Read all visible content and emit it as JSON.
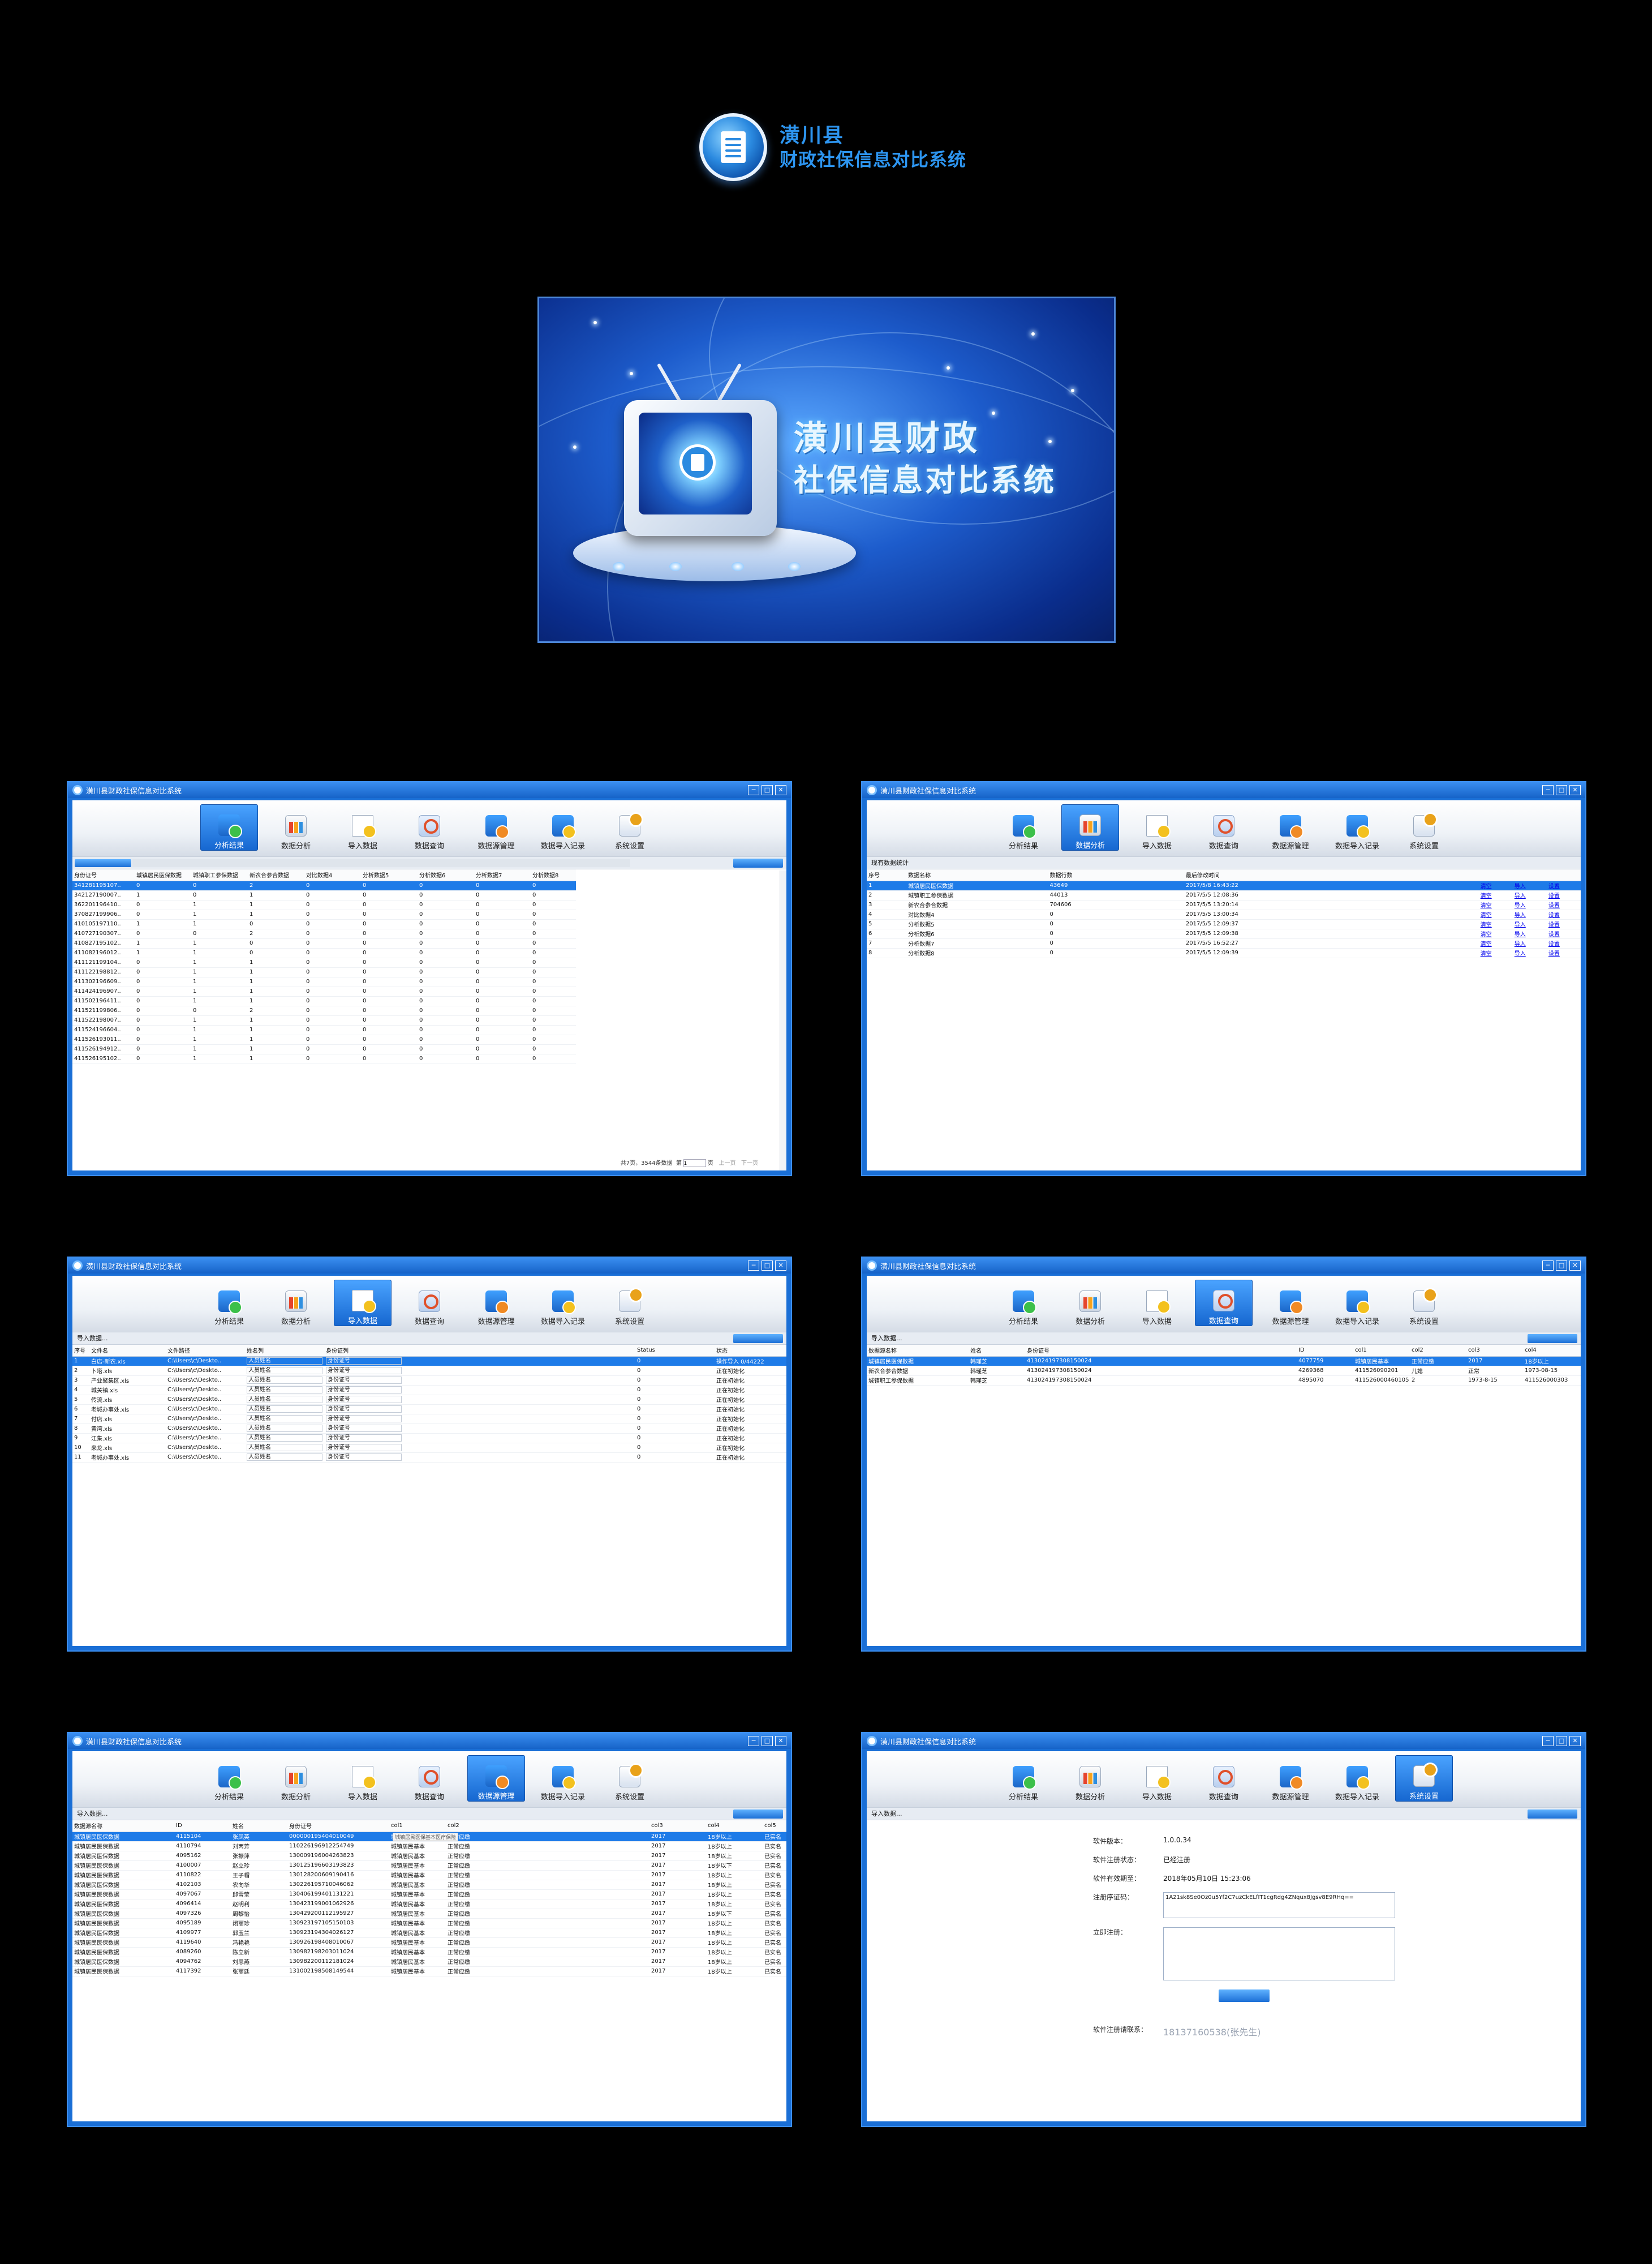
{
  "logo": {
    "line1": "潢川县",
    "line2": "财政社保信息对比系统"
  },
  "splash": {
    "line1": "潢川县财政",
    "line2": "社保信息对比系统"
  },
  "window_title": "潢川县财政社保信息对比系统",
  "window_buttons": [
    "─",
    "□",
    "✕"
  ],
  "tabs": [
    {
      "label": "分析结果",
      "icon": "analysis-result-icon"
    },
    {
      "label": "数据分析",
      "icon": "data-analysis-icon"
    },
    {
      "label": "导入数据",
      "icon": "import-data-icon"
    },
    {
      "label": "数据查询",
      "icon": "data-query-icon"
    },
    {
      "label": "数据源管理",
      "icon": "datasource-manage-icon"
    },
    {
      "label": "数据导入记录",
      "icon": "import-record-icon"
    },
    {
      "label": "系统设置",
      "icon": "settings-icon"
    }
  ],
  "win1": {
    "headers": [
      "身份证号",
      "城镇居民医保数据",
      "城镇职工参保数据",
      "新农合参合数据",
      "对比数据4",
      "分析数据5",
      "分析数据6",
      "分析数据7",
      "分析数据8"
    ],
    "rows": [
      [
        "341281195107..",
        "0",
        "0",
        "2",
        "0",
        "0",
        "0",
        "0",
        "0"
      ],
      [
        "342127190007..",
        "1",
        "0",
        "1",
        "0",
        "0",
        "0",
        "0",
        "0"
      ],
      [
        "362201196410..",
        "0",
        "1",
        "1",
        "0",
        "0",
        "0",
        "0",
        "0"
      ],
      [
        "370827199906..",
        "0",
        "1",
        "1",
        "0",
        "0",
        "0",
        "0",
        "0"
      ],
      [
        "410105197110..",
        "1",
        "1",
        "0",
        "0",
        "0",
        "0",
        "0",
        "0"
      ],
      [
        "410727190307..",
        "0",
        "0",
        "2",
        "0",
        "0",
        "0",
        "0",
        "0"
      ],
      [
        "410827195102..",
        "1",
        "1",
        "0",
        "0",
        "0",
        "0",
        "0",
        "0"
      ],
      [
        "411082196012..",
        "1",
        "1",
        "0",
        "0",
        "0",
        "0",
        "0",
        "0"
      ],
      [
        "411121199104..",
        "0",
        "1",
        "1",
        "0",
        "0",
        "0",
        "0",
        "0"
      ],
      [
        "411122198812..",
        "0",
        "1",
        "1",
        "0",
        "0",
        "0",
        "0",
        "0"
      ],
      [
        "411302196609..",
        "0",
        "1",
        "1",
        "0",
        "0",
        "0",
        "0",
        "0"
      ],
      [
        "411424196907..",
        "0",
        "1",
        "1",
        "0",
        "0",
        "0",
        "0",
        "0"
      ],
      [
        "411502196411..",
        "0",
        "1",
        "1",
        "0",
        "0",
        "0",
        "0",
        "0"
      ],
      [
        "411521199806..",
        "0",
        "0",
        "2",
        "0",
        "0",
        "0",
        "0",
        "0"
      ],
      [
        "411522198007..",
        "0",
        "1",
        "1",
        "0",
        "0",
        "0",
        "0",
        "0"
      ],
      [
        "411524196604..",
        "0",
        "1",
        "1",
        "0",
        "0",
        "0",
        "0",
        "0"
      ],
      [
        "411526193011..",
        "0",
        "1",
        "1",
        "0",
        "0",
        "0",
        "0",
        "0"
      ],
      [
        "411526194912..",
        "0",
        "1",
        "1",
        "0",
        "0",
        "0",
        "0",
        "0"
      ],
      [
        "411526195102..",
        "0",
        "1",
        "1",
        "0",
        "0",
        "0",
        "0",
        "0"
      ]
    ],
    "footer": "共7页，3544条数据",
    "page_label": "第",
    "page_value": "1",
    "page_unit": "页",
    "prev": "上一页",
    "next": "下一页"
  },
  "win2": {
    "strip": "现有数据统计",
    "headers": [
      "序号",
      "数据名称",
      "数据行数",
      "最后修改时间",
      "",
      "",
      ""
    ],
    "rows": [
      [
        "1",
        "城镇居民医保数据",
        "43649",
        "2017/5/8 16:43:22",
        "清空",
        "导入",
        "设置"
      ],
      [
        "2",
        "城镇职工参保数据",
        "44013",
        "2017/5/5 12:08:36",
        "清空",
        "导入",
        "设置"
      ],
      [
        "3",
        "新农合参合数据",
        "704606",
        "2017/5/5 13:20:14",
        "清空",
        "导入",
        "设置"
      ],
      [
        "4",
        "对比数据4",
        "0",
        "2017/5/5 13:00:34",
        "清空",
        "导入",
        "设置"
      ],
      [
        "5",
        "分析数据5",
        "0",
        "2017/5/5 12:09:37",
        "清空",
        "导入",
        "设置"
      ],
      [
        "6",
        "分析数据6",
        "0",
        "2017/5/5 12:09:38",
        "清空",
        "导入",
        "设置"
      ],
      [
        "7",
        "分析数据7",
        "0",
        "2017/5/5 16:52:27",
        "清空",
        "导入",
        "设置"
      ],
      [
        "8",
        "分析数据8",
        "0",
        "2017/5/5 12:09:39",
        "清空",
        "导入",
        "设置"
      ]
    ]
  },
  "win3": {
    "strip": "导入数据...",
    "headers": [
      "序号",
      "文件名",
      "文件路径",
      "姓名列",
      "身份证列",
      "",
      "Status",
      "状态"
    ],
    "rows": [
      [
        "1",
        "白店-新农.xls",
        "C:\\Users\\c\\Deskto..",
        "人员姓名",
        "身份证号",
        "",
        "0",
        "操作导入 0/44222"
      ],
      [
        "2",
        "卜塔.xls",
        "C:\\Users\\c\\Deskto..",
        "人员姓名",
        "身份证号",
        "",
        "0",
        "正在初始化"
      ],
      [
        "3",
        "产业聚集区.xls",
        "C:\\Users\\c\\Deskto..",
        "人员姓名",
        "身份证号",
        "",
        "0",
        "正在初始化"
      ],
      [
        "4",
        "城关镇.xls",
        "C:\\Users\\c\\Deskto..",
        "人员姓名",
        "身份证号",
        "",
        "0",
        "正在初始化"
      ],
      [
        "5",
        "传流.xls",
        "C:\\Users\\c\\Deskto..",
        "人员姓名",
        "身份证号",
        "",
        "0",
        "正在初始化"
      ],
      [
        "6",
        "老城办事处.xls",
        "C:\\Users\\c\\Deskto..",
        "人员姓名",
        "身份证号",
        "",
        "0",
        "正在初始化"
      ],
      [
        "7",
        "付店.xls",
        "C:\\Users\\c\\Deskto..",
        "人员姓名",
        "身份证号",
        "",
        "0",
        "正在初始化"
      ],
      [
        "8",
        "黄湾.xls",
        "C:\\Users\\c\\Deskto..",
        "人员姓名",
        "身份证号",
        "",
        "0",
        "正在初始化"
      ],
      [
        "9",
        "江集.xls",
        "C:\\Users\\c\\Deskto..",
        "人员姓名",
        "身份证号",
        "",
        "0",
        "正在初始化"
      ],
      [
        "10",
        "来龙.xls",
        "C:\\Users\\c\\Deskto..",
        "人员姓名",
        "身份证号",
        "",
        "0",
        "正在初始化"
      ],
      [
        "11",
        "老城办事处.xls",
        "C:\\Users\\c\\Deskto..",
        "人员姓名",
        "身份证号",
        "",
        "0",
        "正在初始化"
      ]
    ]
  },
  "win4": {
    "strip": "导入数据...",
    "headers": [
      "数据源名称",
      "姓名",
      "身份证号",
      "ID",
      "col1",
      "col2",
      "col3",
      "col4"
    ],
    "rows": [
      [
        "城镇居民医保数据",
        "韩瑾芝",
        "413024197308150024",
        "4077759",
        "城镇居民基本",
        "正常应缴",
        "2017",
        "18岁以上"
      ],
      [
        "新农合参合数据",
        "韩瑾芝",
        "413024197308150024",
        "4269368",
        "411526090201",
        "儿媳",
        "正常",
        "1973-08-15"
      ],
      [
        "城镇职工参保数据",
        "韩瑾芝",
        "413024197308150024",
        "4895070",
        "411526000460105",
        "2",
        "1973-8-15",
        "411526000303"
      ]
    ]
  },
  "win5": {
    "strip": "导入数据...",
    "headers": [
      "数据源名称",
      "ID",
      "姓名",
      "身份证号",
      "col1",
      "col2",
      "col3",
      "col4",
      "col5"
    ],
    "tooltip": "城镇居民医保基本医疗保险",
    "rows": [
      [
        "城镇居民医保数据",
        "4115104",
        "张凤英",
        "000000195404010049",
        "城镇居民基本",
        "正常应缴",
        "2017",
        "18岁以上",
        "已实名"
      ],
      [
        "城镇居民医保数据",
        "4110794",
        "刘丙芳",
        "110226196912254749",
        "城镇居民基本",
        "正常应缴",
        "2017",
        "18岁以上",
        "已实名"
      ],
      [
        "城镇居民医保数据",
        "4095162",
        "张振萍",
        "130009196004263823",
        "城镇居民基本",
        "正常应缴",
        "2017",
        "18岁以上",
        "已实名"
      ],
      [
        "城镇居民医保数据",
        "4100007",
        "赵立珍",
        "130125196603193823",
        "城镇居民基本",
        "正常应缴",
        "2017",
        "18岁以下",
        "已实名"
      ],
      [
        "城镇居民医保数据",
        "4110822",
        "王子帽",
        "130128200609190416",
        "城镇居民基本",
        "正常应缴",
        "2017",
        "18岁以上",
        "已实名"
      ],
      [
        "城镇居民医保数据",
        "4102103",
        "农向华",
        "130226195710046062",
        "城镇居民基本",
        "正常应缴",
        "2017",
        "18岁以上",
        "已实名"
      ],
      [
        "城镇居民医保数据",
        "4097067",
        "邱雪莹",
        "130406199401131221",
        "城镇居民基本",
        "正常应缴",
        "2017",
        "18岁以上",
        "已实名"
      ],
      [
        "城镇居民医保数据",
        "4096414",
        "赵明利",
        "130423199001062926",
        "城镇居民基本",
        "正常应缴",
        "2017",
        "18岁以上",
        "已实名"
      ],
      [
        "城镇居民医保数据",
        "4097326",
        "周黎怡",
        "130429200112195927",
        "城镇居民基本",
        "正常应缴",
        "2017",
        "18岁以下",
        "已实名"
      ],
      [
        "城镇居民医保数据",
        "4095189",
        "闭丽珍",
        "130923197105150103",
        "城镇居民基本",
        "正常应缴",
        "2017",
        "18岁以上",
        "已实名"
      ],
      [
        "城镇居民医保数据",
        "4109977",
        "郭玉兰",
        "130923194304026127",
        "城镇居民基本",
        "正常应缴",
        "2017",
        "18岁以上",
        "已实名"
      ],
      [
        "城镇居民医保数据",
        "4119640",
        "冯艳艳",
        "130926198408010067",
        "城镇居民基本",
        "正常应缴",
        "2017",
        "18岁以上",
        "已实名"
      ],
      [
        "城镇居民医保数据",
        "4089260",
        "陈立新",
        "130982198203011024",
        "城镇居民基本",
        "正常应缴",
        "2017",
        "18岁以上",
        "已实名"
      ],
      [
        "城镇居民医保数据",
        "4094762",
        "刘思燕",
        "130982200112181024",
        "城镇居民基本",
        "正常应缴",
        "2017",
        "18岁以上",
        "已实名"
      ],
      [
        "城镇居民医保数据",
        "4117392",
        "张丽廷",
        "131002198508149544",
        "城镇居民基本",
        "正常应缴",
        "2017",
        "18岁以上",
        "已实名"
      ]
    ]
  },
  "win6": {
    "strip": "导入数据...",
    "version_label": "软件版本：",
    "version": "1.0.0.34",
    "reg_status_label": "软件注册状态：",
    "reg_status": "已经注册",
    "expire_label": "软件有效期至：",
    "expire": "2018年05月10日 15:23:06",
    "code_label": "注册序证码：",
    "code": "1A21sk8Se0Oz0u5Yf2C7uzCkELfIT1cgRdg4ZNqux8Jgsv8E9RHq==",
    "manual_label": "立即注册：",
    "contact_label": "软件注册请联系：",
    "contact": "18137160538(张先生)"
  }
}
